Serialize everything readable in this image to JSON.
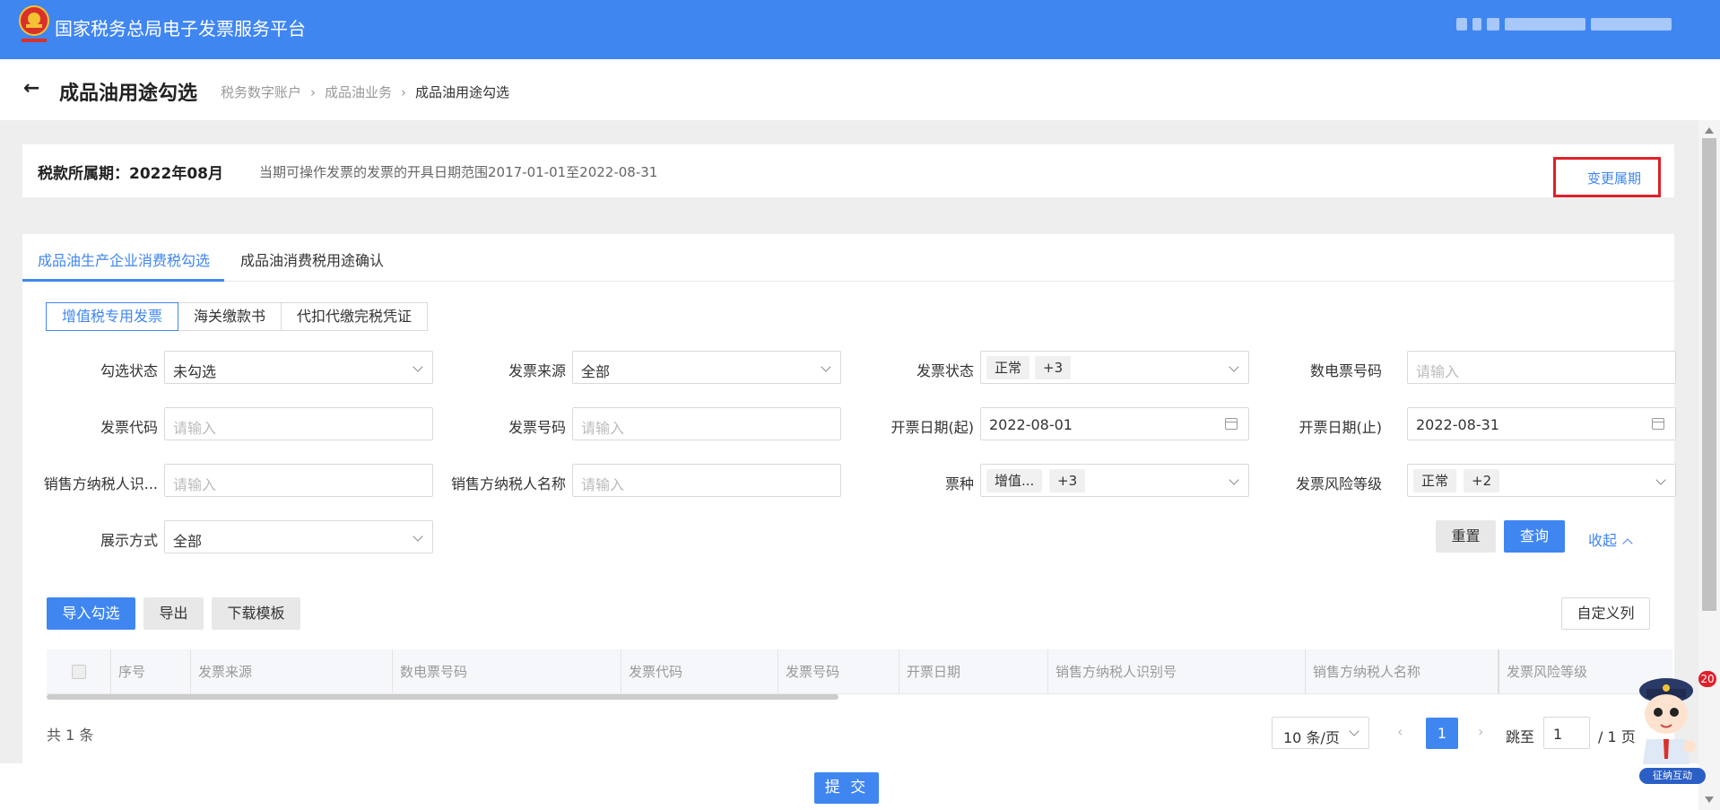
{
  "header": {
    "app_title": "国家税务总局电子发票服务平台",
    "brand_color": "#3f86f1"
  },
  "page": {
    "title": "成品油用途勾选",
    "breadcrumb": [
      "税务数字账户",
      "成品油业务",
      "成品油用途勾选"
    ]
  },
  "period": {
    "label": "税款所属期：2022年08月",
    "note": "当期可操作发票的发票的开具日期范围2017-01-01至2022-08-31",
    "change_link": "变更属期"
  },
  "tabs": [
    "成品油生产企业消费税勾选",
    "成品油消费税用途确认"
  ],
  "doc_types": [
    "增值税专用发票",
    "海关缴款书",
    "代扣代缴完税凭证"
  ],
  "filters": {
    "check_status": {
      "label": "勾选状态",
      "value": "未勾选"
    },
    "invoice_source": {
      "label": "发票来源",
      "value": "全部"
    },
    "invoice_status": {
      "label": "发票状态",
      "tag": "正常",
      "more": "+3"
    },
    "edigital_no": {
      "label": "数电票号码",
      "placeholder": "请输入"
    },
    "invoice_code": {
      "label": "发票代码",
      "placeholder": "请输入"
    },
    "invoice_no": {
      "label": "发票号码",
      "placeholder": "请输入"
    },
    "date_start": {
      "label": "开票日期(起)",
      "value": "2022-08-01"
    },
    "date_end": {
      "label": "开票日期(止)",
      "value": "2022-08-31"
    },
    "seller_tax_id": {
      "label": "销售方纳税人识...",
      "placeholder": "请输入"
    },
    "seller_name": {
      "label": "销售方纳税人名称",
      "placeholder": "请输入"
    },
    "ticket_type": {
      "label": "票种",
      "tag": "增值...",
      "more": "+3"
    },
    "risk_level": {
      "label": "发票风险等级",
      "tag": "正常",
      "more": "+2"
    },
    "display_mode": {
      "label": "展示方式",
      "value": "全部"
    }
  },
  "actions": {
    "reset": "重置",
    "query": "查询",
    "collapse": "收起"
  },
  "toolbar": {
    "import_select": "导入勾选",
    "export": "导出",
    "download_template": "下载模板",
    "custom_columns": "自定义列"
  },
  "table": {
    "columns": [
      "序号",
      "发票来源",
      "数电票号码",
      "发票代码",
      "发票号码",
      "开票日期",
      "销售方纳税人识别号",
      "销售方纳税人名称",
      "发票风险等级"
    ]
  },
  "pagination": {
    "total": "共 1 条",
    "page_size": "10 条/页",
    "prev": "‹",
    "current": "1",
    "next": "›",
    "goto_label": "跳至",
    "goto_value": "1",
    "pages": "/ 1 页"
  },
  "footer": {
    "submit": "提 交"
  },
  "assistant": {
    "badge": "20",
    "label": "征纳互动"
  }
}
